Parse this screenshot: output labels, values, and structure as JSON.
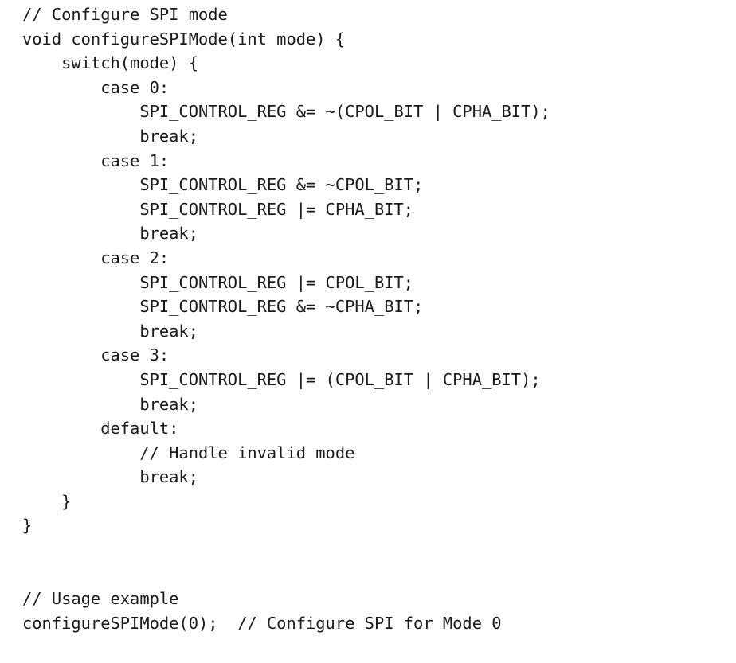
{
  "code": {
    "lines": [
      "// Configure SPI mode",
      "void configureSPIMode(int mode) {",
      "    switch(mode) {",
      "        case 0:",
      "            SPI_CONTROL_REG &= ~(CPOL_BIT | CPHA_BIT);",
      "            break;",
      "        case 1:",
      "            SPI_CONTROL_REG &= ~CPOL_BIT;",
      "            SPI_CONTROL_REG |= CPHA_BIT;",
      "            break;",
      "        case 2:",
      "            SPI_CONTROL_REG |= CPOL_BIT;",
      "            SPI_CONTROL_REG &= ~CPHA_BIT;",
      "            break;",
      "        case 3:",
      "            SPI_CONTROL_REG |= (CPOL_BIT | CPHA_BIT);",
      "            break;",
      "        default:",
      "            // Handle invalid mode",
      "            break;",
      "    }",
      "}",
      "",
      "",
      "// Usage example",
      "configureSPIMode(0);  // Configure SPI for Mode 0"
    ]
  },
  "colors": {
    "text": "#1a1a1a",
    "background": "#ffffff"
  }
}
